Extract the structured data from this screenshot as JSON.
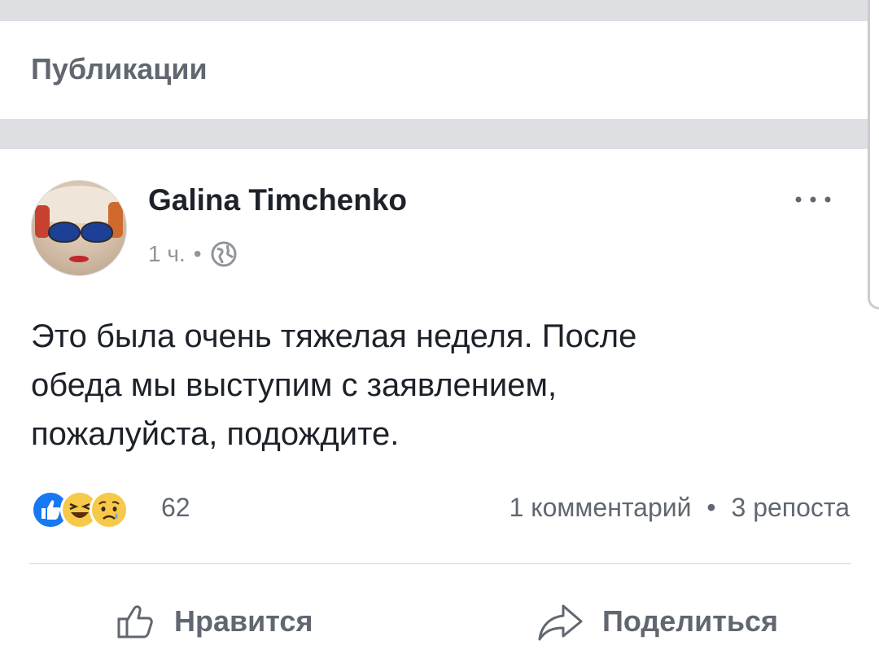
{
  "section": {
    "title": "Публикации"
  },
  "post": {
    "author": "Galina Timchenko",
    "time": "1 ч.",
    "separator": "•",
    "privacy_icon": "globe-icon",
    "more_icon": "more-options-icon",
    "text_lines": [
      "Это была очень тяжелая неделя. После",
      "обеда мы выступим с заявлением,",
      "пожалуйста, подождите."
    ],
    "reactions": {
      "icons": [
        "like-reaction-icon",
        "haha-reaction-icon",
        "sad-reaction-icon"
      ],
      "count": "62"
    },
    "comments": "1 комментарий",
    "shares": "3 репоста",
    "actions": {
      "like": "Нравится",
      "share": "Поделиться"
    }
  },
  "colors": {
    "like_blue": "#1877f2",
    "reaction_yellow": "#f7c94a",
    "text_primary": "#1d2129",
    "text_secondary": "#606770",
    "band_gray": "#dddfe2"
  }
}
